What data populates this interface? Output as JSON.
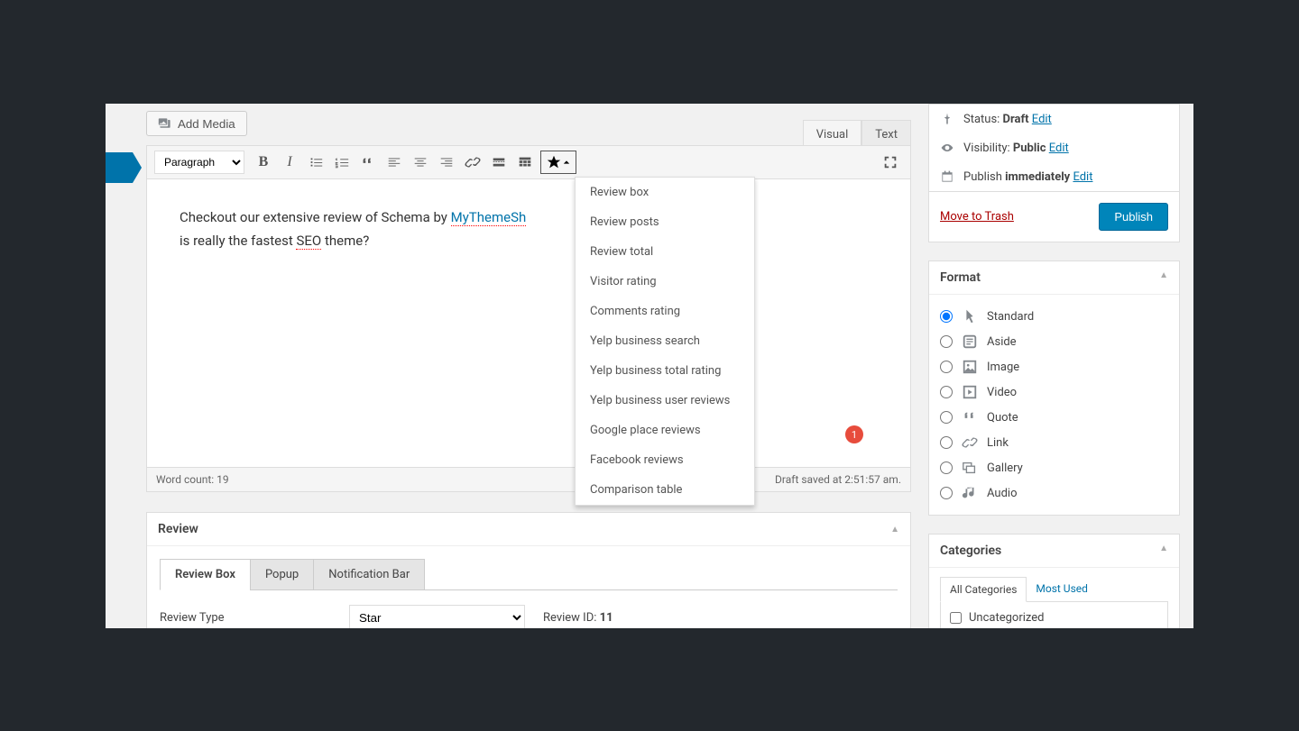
{
  "addMedia": "Add Media",
  "editorTabs": {
    "visual": "Visual",
    "text": "Text"
  },
  "formatSelect": "Paragraph",
  "editorText": {
    "line1a": "Checkout our extensive review of Schema by ",
    "link": "MyThemeSh",
    "line2a": "is really the fastest ",
    "spell": "SEO",
    "line2b": " theme?"
  },
  "dropdown": [
    "Review box",
    "Review posts",
    "Review total",
    "Visitor rating",
    "Comments rating",
    "Yelp business search",
    "Yelp business total rating",
    "Yelp business user reviews",
    "Google place reviews",
    "Facebook reviews",
    "Comparison table"
  ],
  "badge": "1",
  "wordCount": "Word count: 19",
  "draftSaved": "Draft saved at 2:51:57 am.",
  "review": {
    "title": "Review",
    "tabs": [
      "Review Box",
      "Popup",
      "Notification Bar"
    ],
    "typeLabel": "Review Type",
    "typeValue": "Star",
    "idLabel": "Review ID: ",
    "idValue": "11"
  },
  "meta": {
    "statusLabel": "Status: ",
    "statusValue": "Draft",
    "visibilityLabel": "Visibility: ",
    "visibilityValue": "Public",
    "publishLabel": "Publish ",
    "publishValue": "immediately",
    "edit": "Edit",
    "trash": "Move to Trash",
    "publishBtn": "Publish"
  },
  "formatPanel": {
    "title": "Format",
    "items": [
      "Standard",
      "Aside",
      "Image",
      "Video",
      "Quote",
      "Link",
      "Gallery",
      "Audio"
    ]
  },
  "categories": {
    "title": "Categories",
    "tabs": [
      "All Categories",
      "Most Used"
    ],
    "item": "Uncategorized"
  }
}
